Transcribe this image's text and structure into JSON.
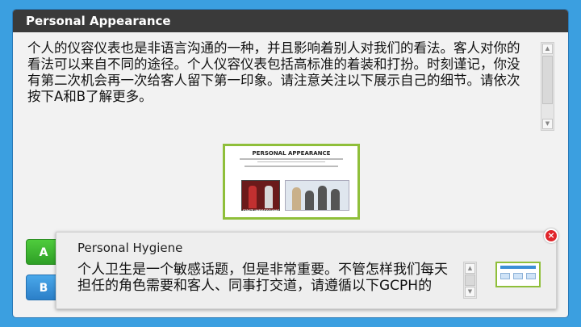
{
  "window": {
    "title": "Personal Appearance",
    "body_text": "个人的仪容仪表也是非语言沟通的一种，并且影响着别人对我们的看法。客人对你的看法可以来自不同的途径。个人仪容仪表包括高标准的着装和打扮。时刻谨记，你没有第二次机会再一次给客人留下第一印象。请注意关注以下展示自己的细节。请依次按下A和B了解更多。"
  },
  "thumbnail": {
    "title": "PERSONAL APPEARANCE",
    "caption": "FIRST IMPRESSIONS"
  },
  "buttons": {
    "a_label": "A",
    "b_label": "B"
  },
  "popup": {
    "title": "Personal Hygiene",
    "text": "个人卫生是一个敏感话题，但是非常重要。不管怎样我们每天担任的角色需要和客人、同事打交道，请遵循以下GCPH的",
    "close_symbol": "×"
  },
  "colors": {
    "background": "#3b9fe0",
    "titlebar": "#3a3a3a",
    "button_a": "#3dbb30",
    "button_b": "#3b95de",
    "close": "#e0252b",
    "thumb_border": "#8fbf3a"
  },
  "icons": [
    "scroll-up-arrow-icon",
    "scroll-down-arrow-icon",
    "close-icon"
  ]
}
